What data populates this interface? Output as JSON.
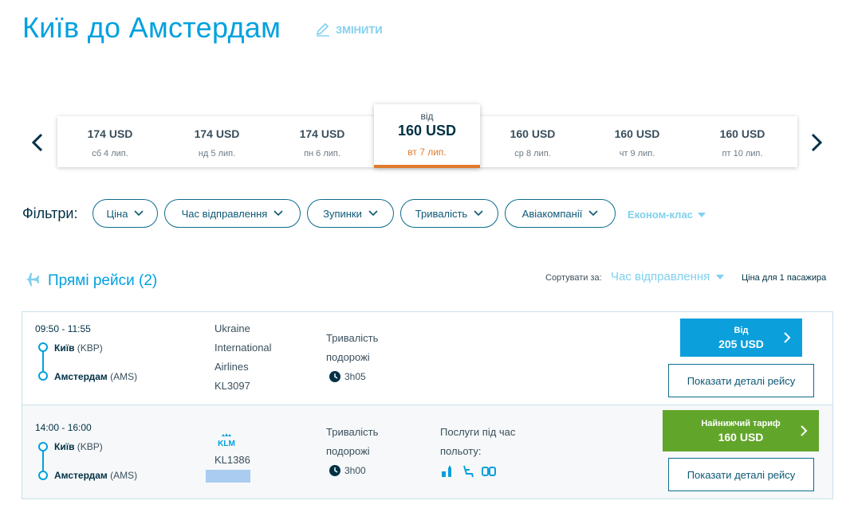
{
  "header": {
    "title": "Київ до Амстердам",
    "change_label": "ЗМІНИТИ"
  },
  "dates": [
    {
      "price": "174 USD",
      "day": "сб 4 лип."
    },
    {
      "price": "174 USD",
      "day": "нд 5 лип."
    },
    {
      "price": "174 USD",
      "day": "пн 6 лип."
    },
    {
      "from": "від",
      "price": "160 USD",
      "day": "вт 7 лип.",
      "selected": true
    },
    {
      "price": "160 USD",
      "day": "ср 8 лип."
    },
    {
      "price": "160 USD",
      "day": "чт 9 лип."
    },
    {
      "price": "160 USD",
      "day": "пт 10 лип."
    }
  ],
  "filters": {
    "label": "Фільтри:",
    "chips": [
      "Ціна",
      "Час відправлення",
      "Зупинки",
      "Тривалість",
      "Авіакомпанії"
    ],
    "cabin": "Економ-клас"
  },
  "results": {
    "section_title": "Прямі рейси (2)",
    "sort_label": "Сортувати за:",
    "sort_value": "Час відправлення",
    "price_note": "Ціна для 1 пасажира"
  },
  "flights": [
    {
      "time": "09:50 - 11:55",
      "origin_city": "Київ",
      "origin_code": "(KBP)",
      "dest_city": "Амстердам",
      "dest_code": "(AMS)",
      "airline_lines": [
        "Ukraine",
        "International",
        "Airlines",
        "KL3097"
      ],
      "duration_label_1": "Тривалість",
      "duration_label_2": "подорожі",
      "duration": "3h05",
      "price_top": "Від",
      "price": "205 USD",
      "details_label": "Показати деталі рейсу"
    },
    {
      "time": "14:00 - 16:00",
      "origin_city": "Київ",
      "origin_code": "(KBP)",
      "dest_city": "Амстердам",
      "dest_code": "(AMS)",
      "airline_logo": "KLM",
      "flight_number": "KL1386",
      "duration_label_1": "Тривалість",
      "duration_label_2": "подорожі",
      "duration": "3h00",
      "services_label_1": "Послуги під час",
      "services_label_2": "польоту:",
      "services_icons": [
        "drinks-icon",
        "seat-recline-icon",
        "seats-icon"
      ],
      "price_top": "Найнижчий тариф",
      "price": "160 USD",
      "details_label": "Показати деталі рейсу"
    }
  ],
  "colors": {
    "accent": "#00a1de",
    "dark": "#003145",
    "blue_button": "#0b9fdc",
    "green_button": "#62a52b",
    "selected_underline": "#e07a2e"
  }
}
